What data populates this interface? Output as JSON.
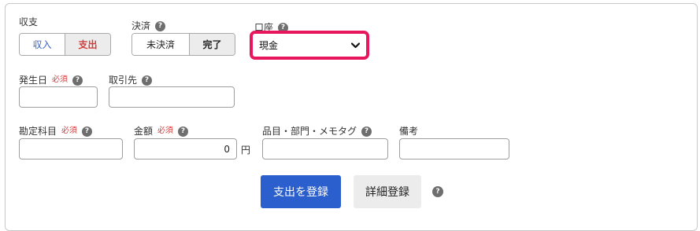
{
  "form": {
    "type": {
      "label": "収支",
      "options": [
        "収入",
        "支出"
      ],
      "selected": "支出"
    },
    "settlement": {
      "label": "決済",
      "options": [
        "未決済",
        "完了"
      ],
      "selected": "完了"
    },
    "account": {
      "label": "口座",
      "selected": "現金"
    },
    "date": {
      "label": "発生日",
      "required": "必須",
      "value": ""
    },
    "partner": {
      "label": "取引先",
      "value": ""
    },
    "category": {
      "label": "勘定科目",
      "required": "必須",
      "value": ""
    },
    "amount": {
      "label": "金額",
      "required": "必須",
      "value": "0",
      "unit": "円"
    },
    "item": {
      "label": "品目・部門・メモタグ",
      "value": ""
    },
    "note": {
      "label": "備考",
      "value": ""
    },
    "help_glyph": "?"
  },
  "actions": {
    "register_label": "支出を登録",
    "detail_label": "詳細登録"
  },
  "colors": {
    "income_text": "#3b62c9",
    "expense_text": "#d23c3c",
    "primary": "#2b5fce",
    "highlight": "#e8175d",
    "selected_bg": "#ececec"
  },
  "icons": {
    "help": "question-circle-icon",
    "select_arrow": "chevron-down-icon"
  }
}
